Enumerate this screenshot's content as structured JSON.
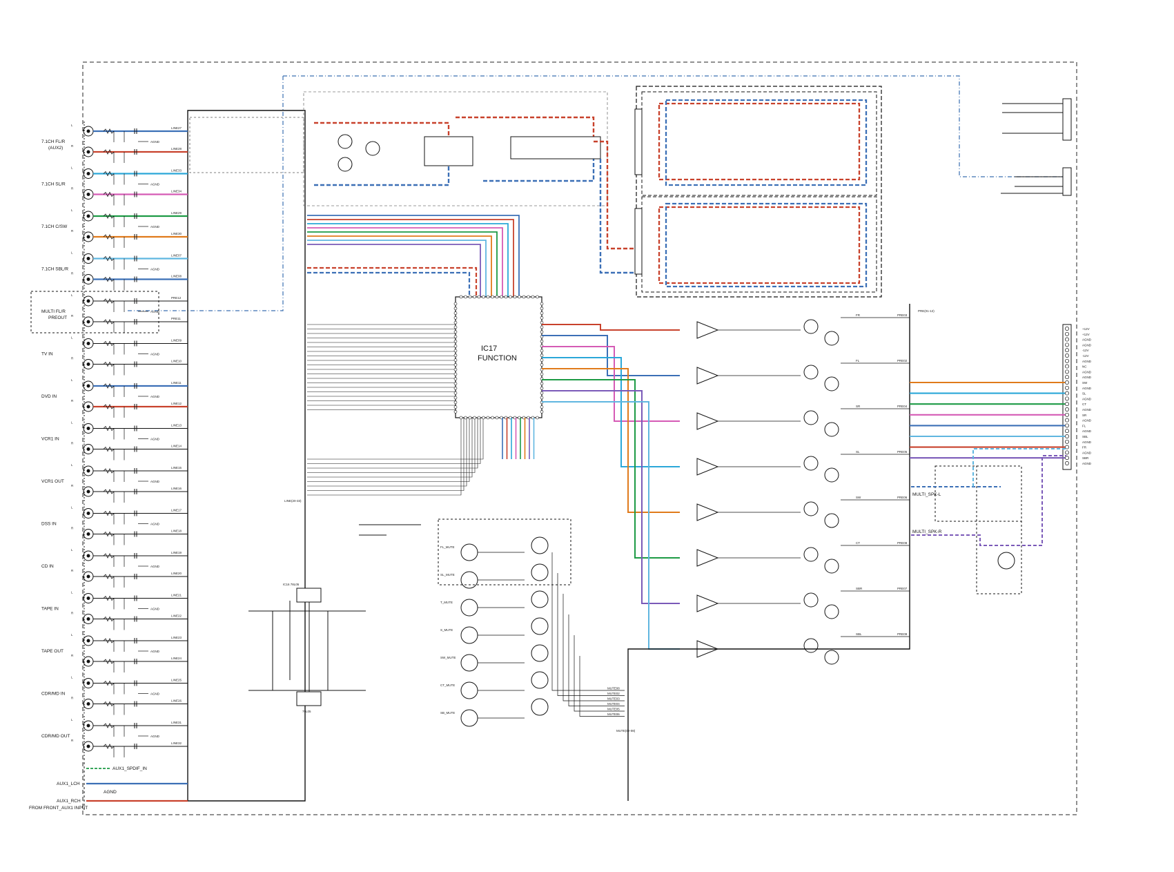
{
  "function_ic": {
    "name": "IC17",
    "label": "FUNCTION"
  },
  "input_groups": [
    {
      "label": "7.1CH FL/R",
      "sub": "(AUX2)",
      "lines": [
        "LINE27",
        "LINE28"
      ]
    },
    {
      "label": "7.1CH SL/R",
      "sub": "",
      "lines": [
        "LINE33",
        "LINE34"
      ]
    },
    {
      "label": "7.1CH C/SW",
      "sub": "",
      "lines": [
        "LINE29",
        "LINE30"
      ]
    },
    {
      "label": "7.1CH SBL/R",
      "sub": "",
      "lines": [
        "LINE07",
        "LINE08"
      ]
    },
    {
      "label": "MULTI FL/R",
      "sub": "PREOUT",
      "lines": [
        "PRE12",
        "PRE11"
      ]
    },
    {
      "label": "TV IN",
      "sub": "",
      "lines": [
        "LINE09",
        "LINE10"
      ]
    },
    {
      "label": "DVD IN",
      "sub": "",
      "lines": [
        "LINE11",
        "LINE12"
      ]
    },
    {
      "label": "VCR1 IN",
      "sub": "",
      "lines": [
        "LINE13",
        "LINE14"
      ]
    },
    {
      "label": "VCR1 OUT",
      "sub": "",
      "lines": [
        "LINE15",
        "LINE16"
      ]
    },
    {
      "label": "DSS IN",
      "sub": "",
      "lines": [
        "LINE17",
        "LINE18"
      ]
    },
    {
      "label": "CD IN",
      "sub": "",
      "lines": [
        "LINE19",
        "LINE20"
      ]
    },
    {
      "label": "TAPE IN",
      "sub": "",
      "lines": [
        "LINE21",
        "LINE22"
      ]
    },
    {
      "label": "TAPE OUT",
      "sub": "",
      "lines": [
        "LINE23",
        "LINE24"
      ]
    },
    {
      "label": "CDR/MD IN",
      "sub": "",
      "lines": [
        "LINE25",
        "LINE26"
      ]
    },
    {
      "label": "CDR/MD OUT",
      "sub": "",
      "lines": [
        "LINE31",
        "LINE32"
      ]
    }
  ],
  "front_input": {
    "spdif": "AUX1_SPDIF_IN",
    "lch": "AUX1_LCH",
    "rch": "AUX1_RCH",
    "agnd": "AGND",
    "caption": "FROM FRONT_AUX1 INPUT"
  },
  "output_connector": {
    "pins": [
      "+12V",
      "+12V",
      "AGND",
      "AGND",
      "-12V",
      "-12V",
      "AGND",
      "NC",
      "AGND",
      "AGND",
      "SW",
      "AGND",
      "SL",
      "AGND",
      "CT",
      "AGND",
      "SR",
      "AGND",
      "FL",
      "AGND",
      "SBL",
      "AGND",
      "FR",
      "AGND",
      "SBR",
      "AGND"
    ]
  },
  "amp_channels": [
    {
      "name": "FR",
      "pre": "PRE03"
    },
    {
      "name": "FL",
      "pre": "PRE02"
    },
    {
      "name": "SR",
      "pre": "PRE04"
    },
    {
      "name": "SL",
      "pre": "PRE05"
    },
    {
      "name": "SW",
      "pre": "PRE06"
    },
    {
      "name": "CT",
      "pre": "PRE08"
    },
    {
      "name": "SBR",
      "pre": "PRE07"
    },
    {
      "name": "SBL",
      "pre": "PRE09"
    }
  ],
  "multi_spk": [
    "MULTI_SPK-L",
    "MULTI_SPK-R"
  ],
  "mute_lines": [
    "MUTE08",
    "MUTE02",
    "MUTE03",
    "MUTE04",
    "MUTE05",
    "MUTE06"
  ],
  "mute_drivers": [
    "FL_MUTE",
    "SL_MUTE",
    "T_MUTE",
    "S_MUTE",
    "SW_MUTE",
    "CT_MUTE",
    "SB_MUTE"
  ],
  "regulator": {
    "top": "IC16 78L05",
    "bottom": "79L05"
  },
  "bus_labels": {
    "line_bus": "LINE(20-33)",
    "mute_bus": "MUTE(02-08)",
    "pre_bus": "PRE(01-12)"
  },
  "colors": {
    "blue": "#3b6fb6",
    "red": "#c8412b",
    "cyan": "#2aa7d8",
    "magenta": "#d55ab5",
    "green": "#1c9a44",
    "orange": "#e07a1a",
    "purple": "#7a59b8",
    "lightblue": "#5fb6e0",
    "dash_blue": "#3a6fb0",
    "dash_gray": "#555555"
  }
}
